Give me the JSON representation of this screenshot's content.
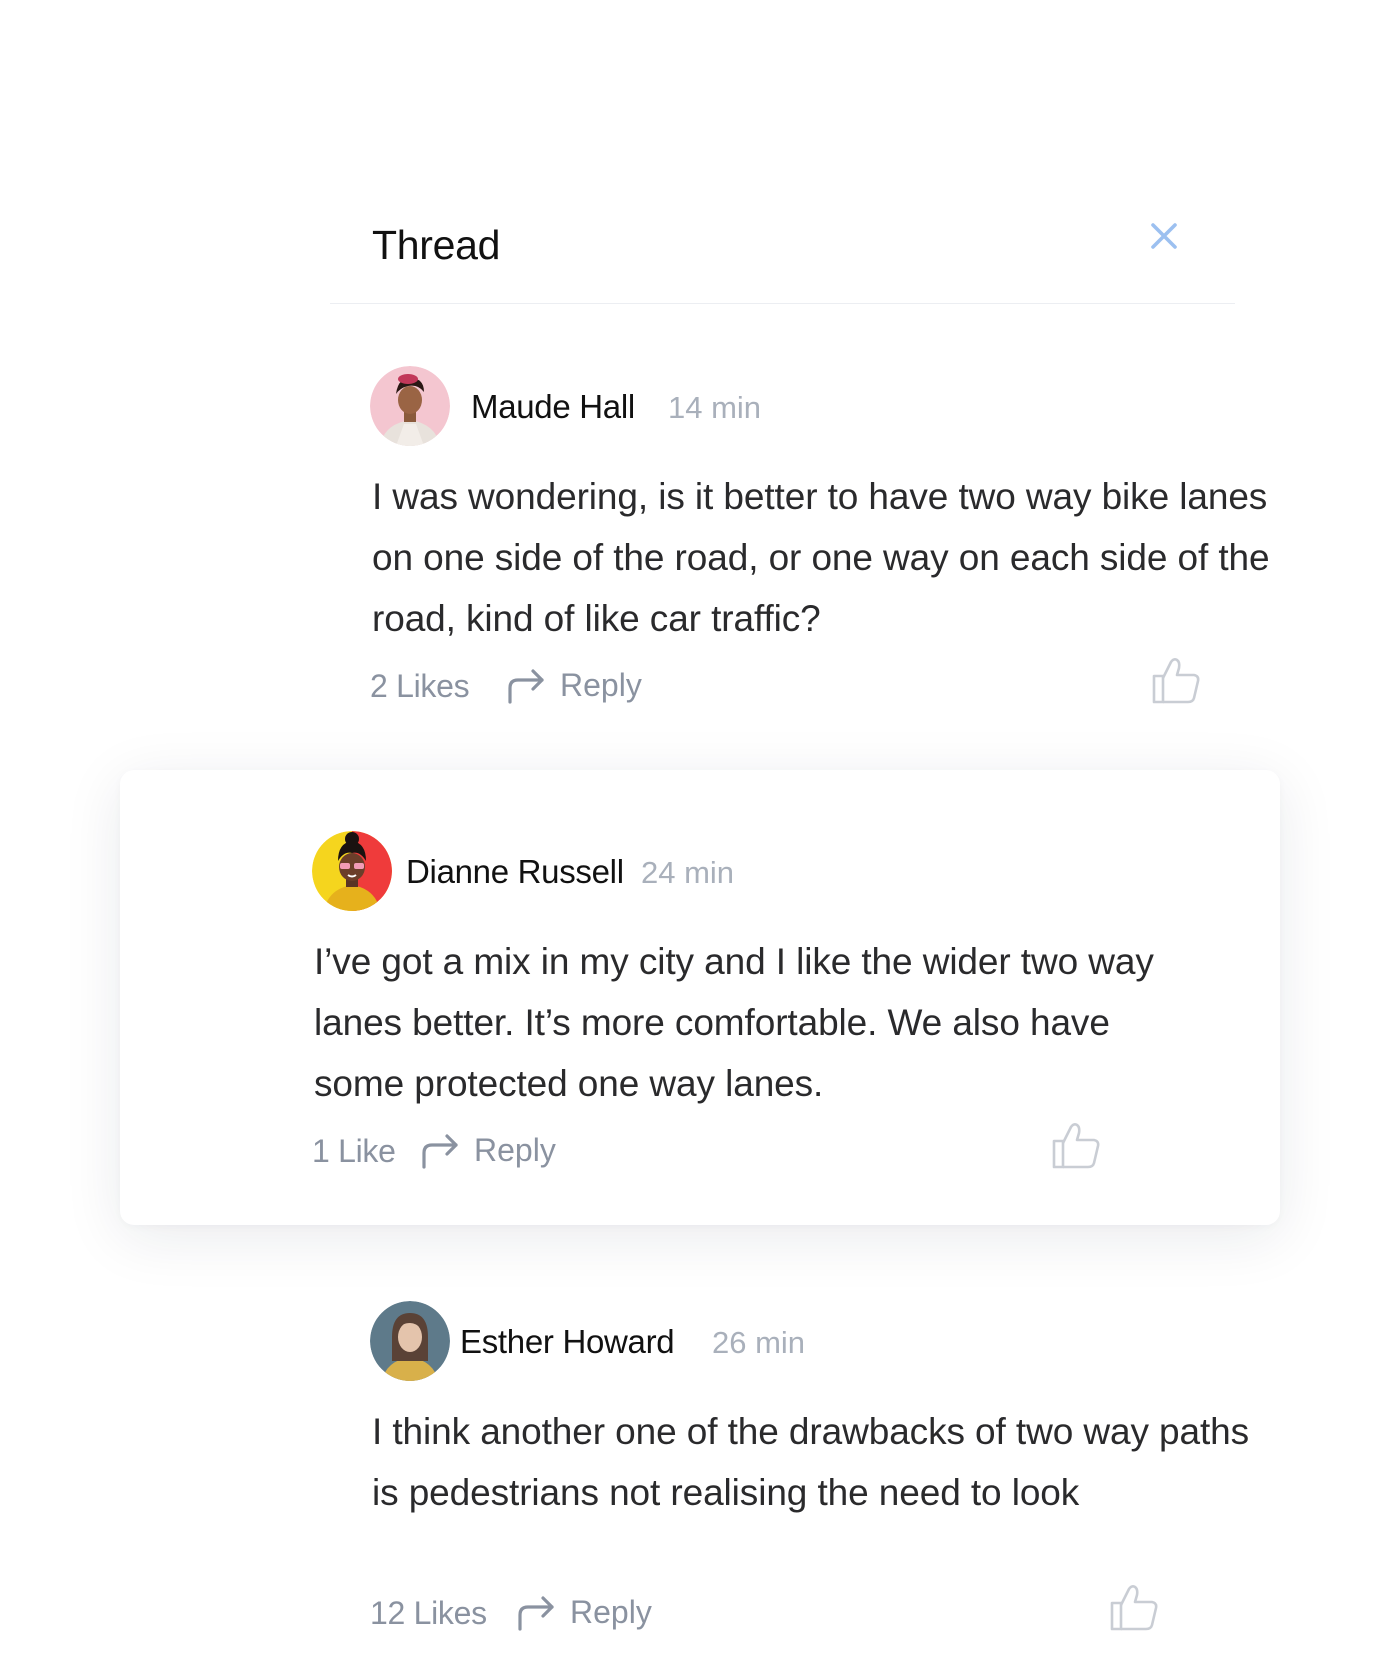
{
  "thread": {
    "title": "Thread",
    "close_icon": "close-icon",
    "accent_color": "#9cc0f0"
  },
  "comments": [
    {
      "author": "Maude Hall",
      "time": "14 min",
      "body": "I was wondering, is it better to have two way bike lanes on one side of the road, or one way on each side of the road, kind of like car traffic?",
      "likes": "2 Likes",
      "reply": "Reply"
    },
    {
      "author": "Dianne Russell",
      "time": "24 min",
      "body": "I’ve got a mix in my city and I like the wider two way lanes better. It’s more comfortable. We also have some protected one way lanes.",
      "likes": "1 Like",
      "reply": "Reply",
      "highlighted": true
    },
    {
      "author": "Esther Howard",
      "time": "26 min",
      "body": "I think another one of the drawbacks of two way paths is pedestrians not realising the need to look",
      "likes": "12 Likes",
      "reply": "Reply"
    }
  ],
  "icons": {
    "reply": "reply-arrow-icon",
    "like": "thumbs-up-icon",
    "close": "close-icon"
  },
  "colors": {
    "muted_text": "#8a92a0",
    "time_text": "#a9b0bb",
    "divider": "#eceef2"
  }
}
